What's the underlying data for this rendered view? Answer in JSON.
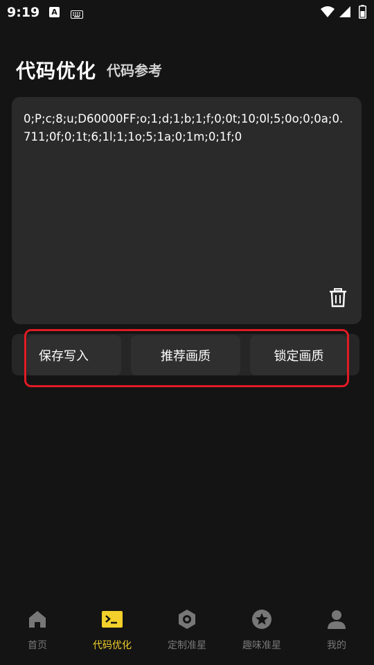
{
  "status_bar": {
    "time": "9:19",
    "a_icon_letter": "A"
  },
  "header": {
    "title": "代码优化",
    "subtitle": "代码参考"
  },
  "editor": {
    "code": "0;P;c;8;u;D60000FF;o;1;d;1;b;1;f;0;0t;10;0l;5;0o;0;0a;0.711;0f;0;1t;6;1l;1;1o;5;1a;0;1m;0;1f;0"
  },
  "actions": {
    "save_label": "保存写入",
    "recommend_label": "推荐画质",
    "lock_label": "锁定画质"
  },
  "nav": {
    "items": [
      {
        "label": "首页",
        "icon": "home-icon"
      },
      {
        "label": "代码优化",
        "icon": "terminal-icon"
      },
      {
        "label": "定制准星",
        "icon": "hexagon-nut-icon"
      },
      {
        "label": "趣味准星",
        "icon": "star-circle-icon"
      },
      {
        "label": "我的",
        "icon": "person-icon"
      }
    ],
    "active_index": 1
  },
  "colors": {
    "accent": "#f3d02b",
    "highlight": "#e01b24",
    "card": "#2a2a2a",
    "background": "#141414"
  }
}
